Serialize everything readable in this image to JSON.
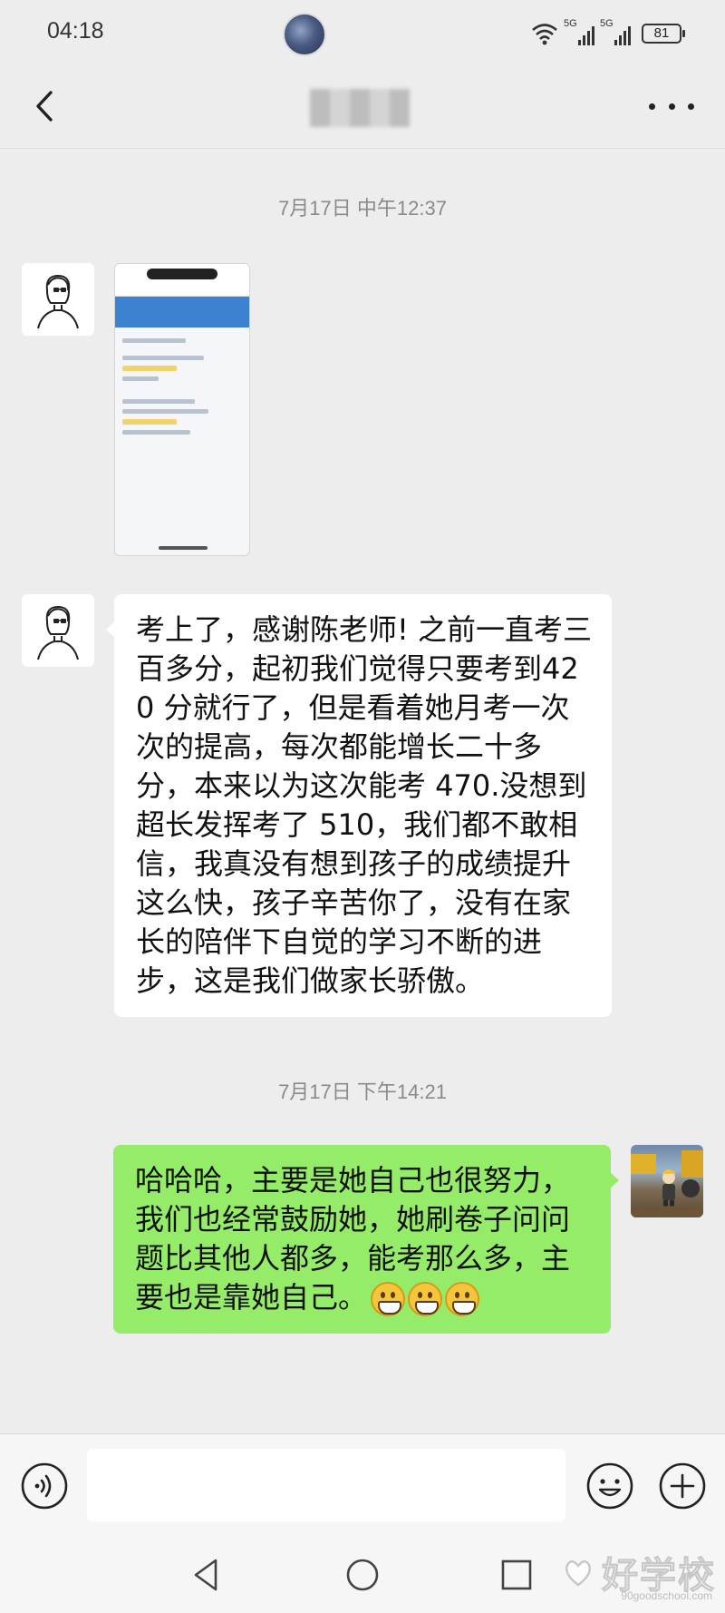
{
  "status_bar": {
    "time": "04:18",
    "network_1": "5G",
    "network_2": "5G",
    "battery": "81"
  },
  "nav": {
    "title": "",
    "back_icon": "chevron-left-icon",
    "more_icon": "more-horizontal-icon"
  },
  "messages": [
    {
      "type": "timestamp",
      "text": "7月17日 中午12:37"
    },
    {
      "type": "image",
      "sender": "contact",
      "content": "screenshot-thumbnail"
    },
    {
      "type": "text",
      "sender": "contact",
      "text": "考上了，感谢陈老师! 之前一直考三百多分，起初我们觉得只要考到420 分就行了，但是看着她月考一次次的提高，每次都能增长二十多分，本来以为这次能考 470.没想到超长发挥考了 510，我们都不敢相信，我真没有想到孩子的成绩提升这么快，孩子辛苦你了，没有在家长的陪伴下自觉的学习不断的进步，这是我们做家长骄傲。"
    },
    {
      "type": "timestamp",
      "text": "7月17日 下午14:21"
    },
    {
      "type": "text",
      "sender": "self",
      "text": "哈哈哈，主要是她自己也很努力，我们也经常鼓励她，她刷卷子问问题比其他人都多，能考那么多，主要也是靠她自己。",
      "emojis": [
        "grin-emoji",
        "grin-emoji",
        "grin-emoji"
      ]
    }
  ],
  "input_bar": {
    "voice_icon": "voice-icon",
    "input_value": "",
    "emoji_icon": "emoji-icon",
    "plus_icon": "plus-icon"
  },
  "system_nav": {
    "back_icon": "triangle-back-icon",
    "home_icon": "circle-home-icon",
    "recents_icon": "square-recents-icon"
  },
  "watermark": {
    "text": "好学校",
    "url": "90goodschool.com"
  },
  "colors": {
    "background": "#ededed",
    "outgoing_bubble": "#95ec69",
    "incoming_bubble": "#ffffff",
    "timestamp": "#8a8a8a"
  }
}
